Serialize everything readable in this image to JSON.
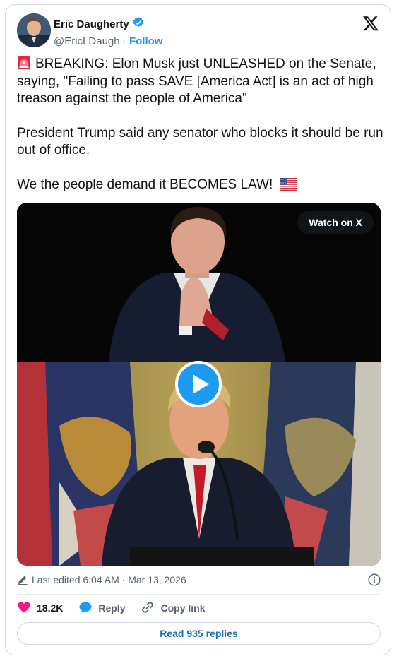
{
  "author": {
    "name": "Eric Daugherty",
    "handle": "@EricLDaugh",
    "separator": " · ",
    "follow_label": "Follow"
  },
  "tweet": {
    "line1": "BREAKING: Elon Musk just UNLEASHED on the Senate, saying, \"Failing to pass SAVE [America Act] is an act of high treason against the people of America\"",
    "line2": "President Trump said any senator who blocks it should be run out of office.",
    "line3": "We the people demand it BECOMES LAW!",
    "icons": [
      "rotating-light-icon",
      "us-flag-icon"
    ]
  },
  "media": {
    "watch_label": "Watch on X",
    "icons": [
      "play-icon"
    ]
  },
  "meta": {
    "edited_text": "Last edited 6:04 AM · Mar 13, 2026",
    "icons": [
      "pencil-icon",
      "info-icon"
    ]
  },
  "actions": {
    "like_count": "18.2K",
    "reply_label": "Reply",
    "copy_label": "Copy link"
  },
  "replies_button": "Read 935 replies",
  "colors": {
    "accent": "#1d9bf0",
    "like": "#f91880",
    "text": "#0f1419",
    "muted": "#536471",
    "border": "#cfd9de"
  }
}
